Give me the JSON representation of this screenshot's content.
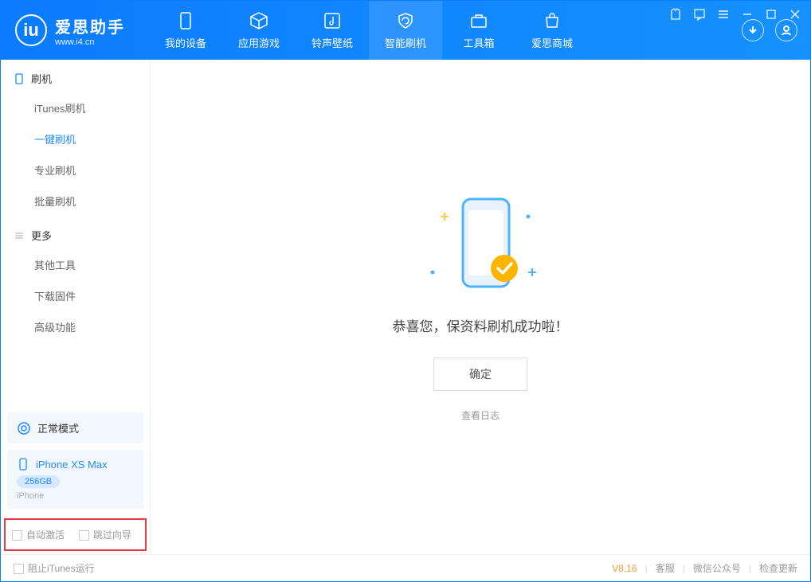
{
  "logo": {
    "title": "爱思助手",
    "subtitle": "www.i4.cn"
  },
  "tabs": {
    "device": "我的设备",
    "apps": "应用游戏",
    "ring": "铃声壁纸",
    "flash": "智能刷机",
    "tools": "工具箱",
    "store": "爱思商城"
  },
  "sidebar": {
    "section_flash": "刷机",
    "items_flash": {
      "itunes": "iTunes刷机",
      "onekey": "一键刷机",
      "pro": "专业刷机",
      "batch": "批量刷机"
    },
    "section_more": "更多",
    "items_more": {
      "other": "其他工具",
      "firmware": "下载固件",
      "advanced": "高级功能"
    }
  },
  "status": {
    "mode": "正常模式"
  },
  "device": {
    "name": "iPhone XS Max",
    "capacity": "256GB",
    "type": "iPhone"
  },
  "checkboxes": {
    "auto_activate": "自动激活",
    "skip_guide": "跳过向导"
  },
  "main": {
    "success_message": "恭喜您，保资料刷机成功啦！",
    "confirm": "确定",
    "view_log": "查看日志"
  },
  "footer": {
    "block_itunes": "阻止iTunes运行",
    "version": "V8.16",
    "support": "客服",
    "wechat": "微信公众号",
    "update": "检查更新"
  }
}
